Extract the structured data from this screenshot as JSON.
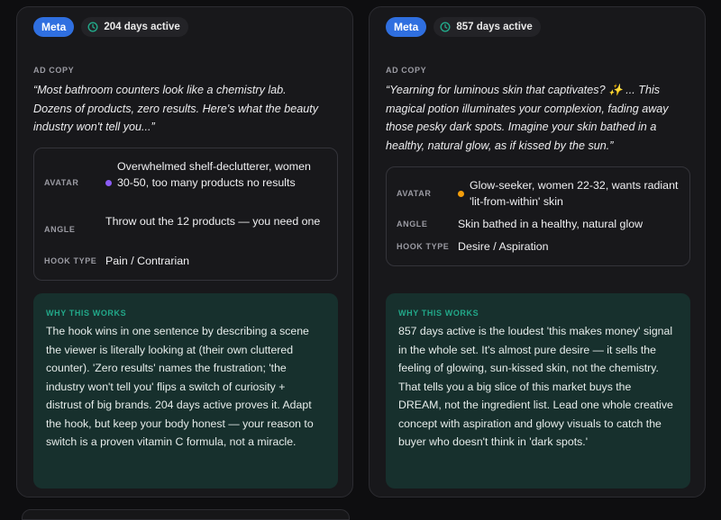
{
  "cards": [
    {
      "platform_badge": "Meta",
      "active_days": "204 days active",
      "ad_copy_label": "AD COPY",
      "ad_copy": "“Most bathroom counters look like a chemistry lab. Dozens of products, zero results. Here's what the beauty industry won't tell you...”",
      "avatar_label": "AVATAR",
      "avatar_value": "Overwhelmed shelf-declutterer, women 30-50, too many products no results",
      "avatar_dot_color": "#8b5cf6",
      "angle_label": "ANGLE",
      "angle_value": "Throw out the 12 products — you need one",
      "hook_label": "HOOK TYPE",
      "hook_value": "Pain / Contrarian",
      "why_label": "WHY THIS WORKS",
      "why_text": "The hook wins in one sentence by describing a scene the viewer is literally looking at (their own cluttered counter). 'Zero results' names the frustration; 'the industry won't tell you' flips a switch of curiosity + distrust of big brands. 204 days active proves it. Adapt the hook, but keep your body honest — your reason to switch is a proven vitamin C formula, not a miracle."
    },
    {
      "platform_badge": "Meta",
      "active_days": "857 days active",
      "ad_copy_label": "AD COPY",
      "ad_copy": "“Yearning for luminous skin that captivates? ✨ ... This magical potion illuminates your complexion, fading away those pesky dark spots. Imagine your skin bathed in a healthy, natural glow, as if kissed by the sun.”",
      "avatar_label": "AVATAR",
      "avatar_value": "Glow-seeker, women 22-32, wants radiant 'lit-from-within' skin",
      "avatar_dot_color": "#f59e0b",
      "angle_label": "ANGLE",
      "angle_value": "Skin bathed in a healthy, natural glow",
      "hook_label": "HOOK TYPE",
      "hook_value": "Desire / Aspiration",
      "why_label": "WHY THIS WORKS",
      "why_text": "857 days active is the loudest 'this makes money' signal in the whole set. It's almost pure desire — it sells the feeling of glowing, sun-kissed skin, not the chemistry. That tells you a big slice of this market buys the DREAM, not the ingredient list. Lead one whole creative concept with aspiration and glowy visuals to catch the buyer who doesn't think in 'dark spots.'"
    }
  ],
  "colors": {
    "meta_badge": "#2f6fe0",
    "why_label": "#22a889",
    "why_bg": "#17302d",
    "card_bg": "#18181b"
  },
  "icons": {
    "active_days": "clock-icon"
  }
}
